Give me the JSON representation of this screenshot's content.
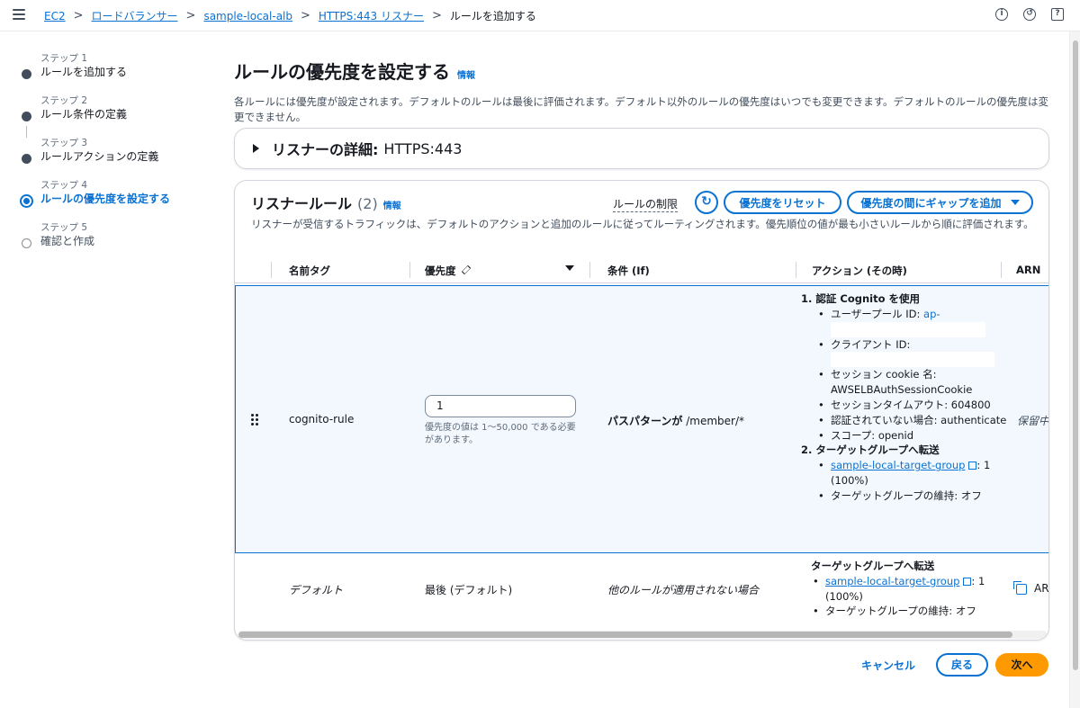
{
  "breadcrumb": {
    "items": [
      "EC2",
      "ロードバランサー",
      "sample-local-alb",
      "HTTPS:443 リスナー"
    ],
    "current": "ルールを追加する"
  },
  "steps": [
    {
      "num": "ステップ 1",
      "label": "ルールを追加する"
    },
    {
      "num": "ステップ 2",
      "label": "ルール条件の定義"
    },
    {
      "num": "ステップ 3",
      "label": "ルールアクションの定義"
    },
    {
      "num": "ステップ 4",
      "label": "ルールの優先度を設定する"
    },
    {
      "num": "ステップ 5",
      "label": "確認と作成"
    }
  ],
  "page": {
    "title": "ルールの優先度を設定する",
    "info": "情報",
    "description": "各ルールには優先度が設定されます。デフォルトのルールは最後に評価されます。デフォルト以外のルールの優先度はいつでも変更できます。デフォルトのルールの優先度は変更できません。"
  },
  "listener": {
    "label": "リスナーの詳細:",
    "value": "HTTPS:443"
  },
  "rules": {
    "title": "リスナールール",
    "count": "(2)",
    "info": "情報",
    "limit_link": "ルールの制限",
    "reset_button": "優先度をリセット",
    "gap_button": "優先度の間にギャップを追加",
    "description": "リスナーが受信するトラフィックは、デフォルトのアクションと追加のルールに従ってルーティングされます。優先順位の値が最も小さいルールから順に評価されます。",
    "columns": [
      "名前タグ",
      "優先度",
      "条件 (If)",
      "アクション (その時)",
      "ARN"
    ]
  },
  "row1": {
    "name": "cognito-rule",
    "priority": "1",
    "priority_hint": "優先度の値は 1〜50,000 である必要があります。",
    "condition_bold": "パスパターンが",
    "condition_value": " /member/*",
    "arn": "保留中",
    "action1_title": "1. 認証 Cognito を使用",
    "action1_items": [
      {
        "label": "ユーザープール ID: ",
        "link": "ap-"
      },
      {
        "label": "クライアント ID:"
      },
      {
        "label": "セッション cookie 名: AWSELBAuthSessionCookie"
      },
      {
        "label": "セッションタイムアウト: 604800"
      },
      {
        "label": "認証されていない場合: authenticate"
      },
      {
        "label": "スコープ: openid"
      }
    ],
    "action2_title": "2. ターゲットグループへ転送",
    "action2_link": "sample-local-target-group",
    "action2_link_suffix": ": 1 (100%)",
    "action2_item2": "ターゲットグループの維持: オフ"
  },
  "row2": {
    "name": "デフォルト",
    "priority": "最後 (デフォルト)",
    "condition": "他のルールが適用されない場合",
    "action_title": "ターゲットグループへ転送",
    "action_link": "sample-local-target-group",
    "action_link_suffix": ": 1 (100%)",
    "action_item2": "ターゲットグループの維持: オフ",
    "arn": "AR"
  },
  "footer": {
    "cancel": "キャンセル",
    "back": "戻る",
    "next": "次へ"
  },
  "colors": {
    "accent": "#0972d3",
    "primary_button": "#ff9900",
    "selected_row": "#f2f8fd"
  }
}
